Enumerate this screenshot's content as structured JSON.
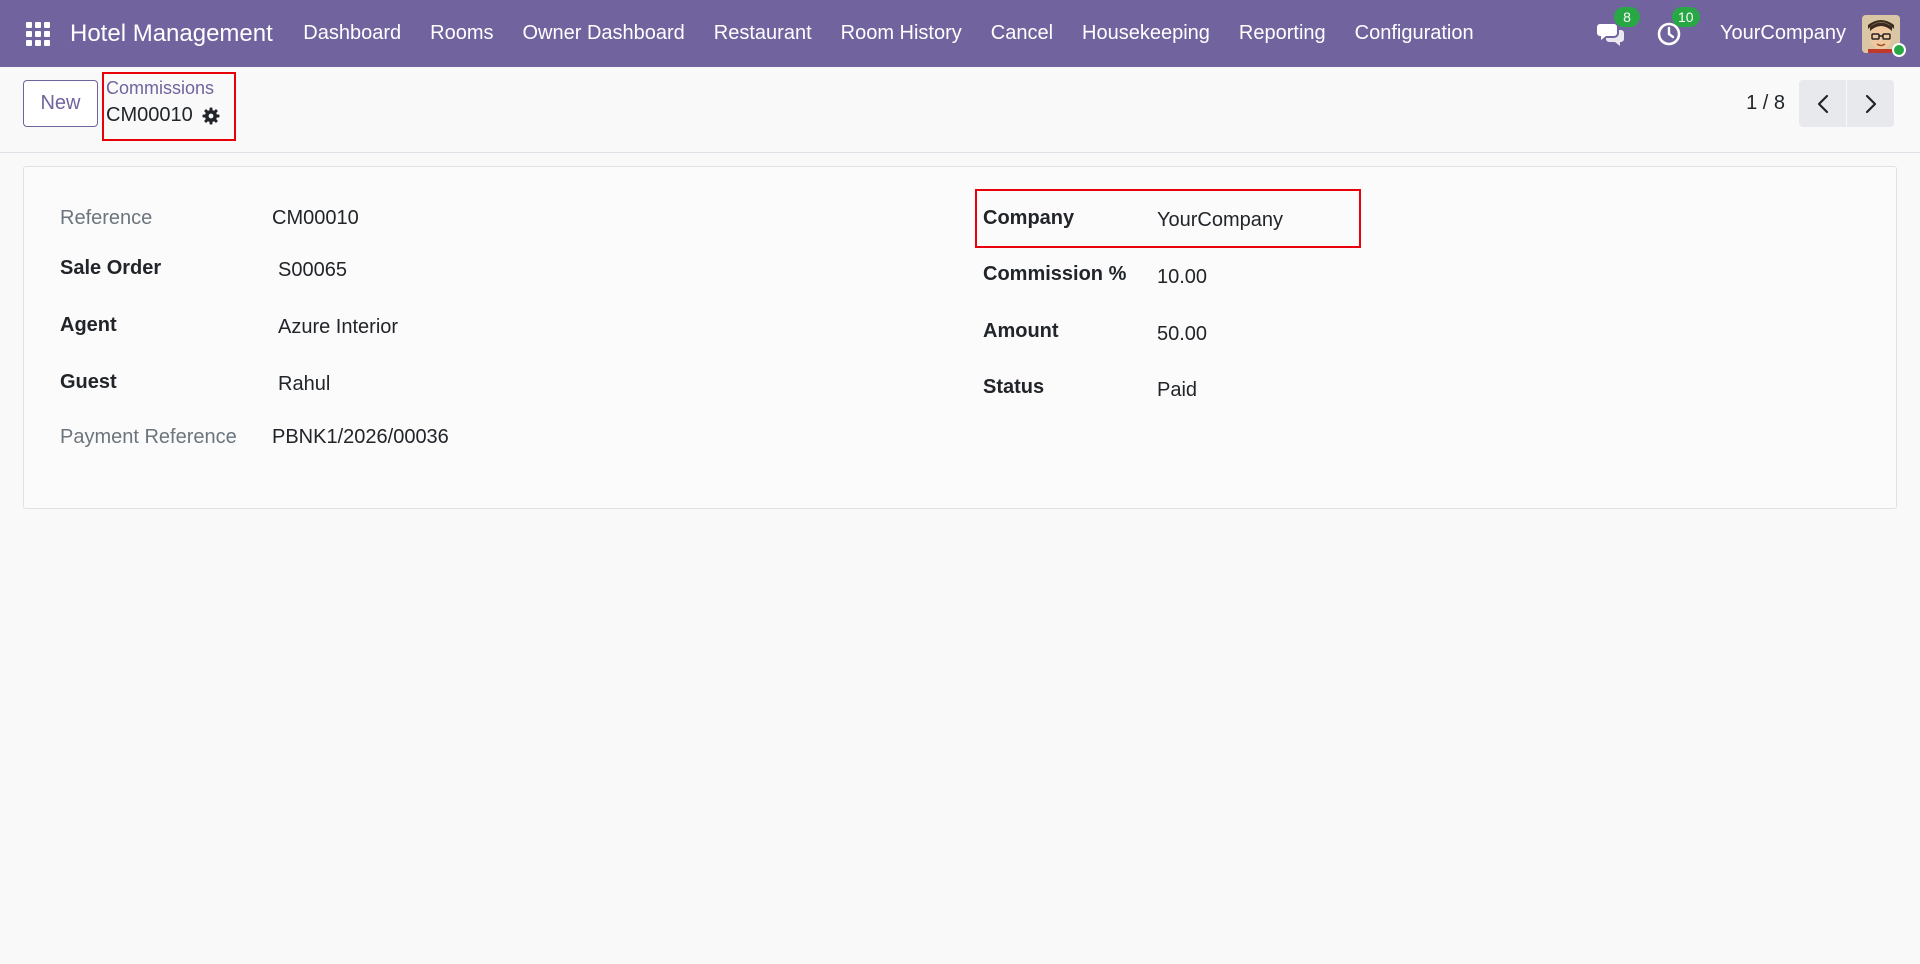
{
  "navbar": {
    "app_title": "Hotel Management",
    "menu": [
      "Dashboard",
      "Rooms",
      "Owner Dashboard",
      "Restaurant",
      "Room History",
      "Cancel",
      "Housekeeping",
      "Reporting",
      "Configuration"
    ],
    "messages_badge": "8",
    "activities_badge": "10",
    "company": "YourCompany"
  },
  "control_panel": {
    "new_label": "New",
    "breadcrumb_parent": "Commissions",
    "breadcrumb_current": "CM00010",
    "pager_value": "1 / 8"
  },
  "form": {
    "left": [
      {
        "label": "Reference",
        "value": "CM00010"
      },
      {
        "label": "Sale Order",
        "value": "S00065"
      },
      {
        "label": "Agent",
        "value": "Azure Interior"
      },
      {
        "label": "Guest",
        "value": "Rahul"
      },
      {
        "label": "Payment Reference",
        "value": "PBNK1/2026/00036"
      }
    ],
    "right": [
      {
        "label": "Company",
        "value": "YourCompany"
      },
      {
        "label": "Commission %",
        "value": "10.00"
      },
      {
        "label": "Amount",
        "value": "50.00"
      },
      {
        "label": "Status",
        "value": "Paid"
      }
    ]
  },
  "colors": {
    "brand": "#71639e",
    "badge": "#28a745",
    "highlight": "#e8000b"
  }
}
